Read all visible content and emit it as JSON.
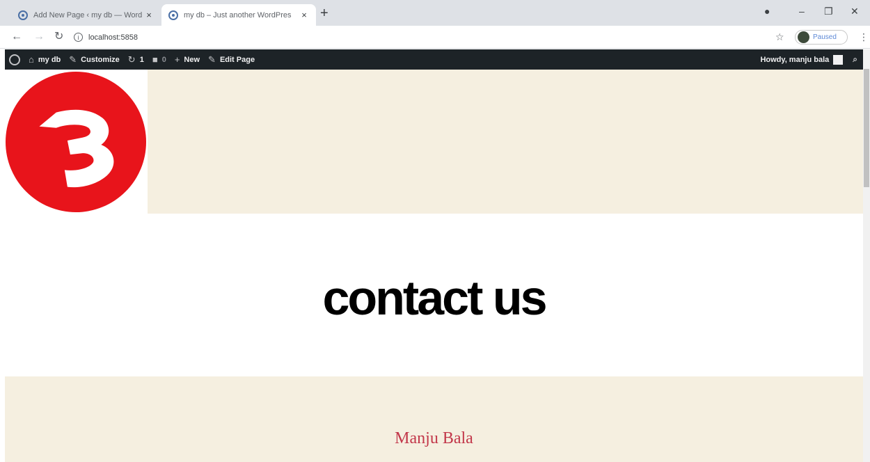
{
  "browser": {
    "tabs": [
      {
        "title": "Add New Page ‹ my db — Word",
        "close": "×",
        "active": false
      },
      {
        "title": "my db – Just another WordPres",
        "close": "×",
        "active": true
      }
    ],
    "new_tab": "+",
    "window_controls": {
      "minimize": "–",
      "restore": "❐",
      "close": "✕"
    },
    "url": "localhost:5858",
    "profile_label": "Paused",
    "icons": {
      "back": "←",
      "forward": "→",
      "reload": "↻",
      "info": "i",
      "star": "☆",
      "menu": "⋮"
    }
  },
  "adminbar": {
    "items": [
      {
        "icon": "⌂",
        "label": "my db"
      },
      {
        "icon": "✎",
        "label": "Customize"
      },
      {
        "icon": "↻",
        "label": "1"
      },
      {
        "icon": "■",
        "label": "0"
      },
      {
        "icon": "+",
        "label": "New"
      },
      {
        "icon": "✎",
        "label": "Edit Page"
      }
    ],
    "howdy": "Howdy, manju bala",
    "search_icon": "⌕"
  },
  "page": {
    "title": "contact us",
    "author_name": "Manju Bala"
  },
  "colors": {
    "header_bg": "#f5efe0",
    "logo_red": "#e8141b",
    "admin_bar": "#1d2327",
    "accent_name": "#c2374a"
  }
}
